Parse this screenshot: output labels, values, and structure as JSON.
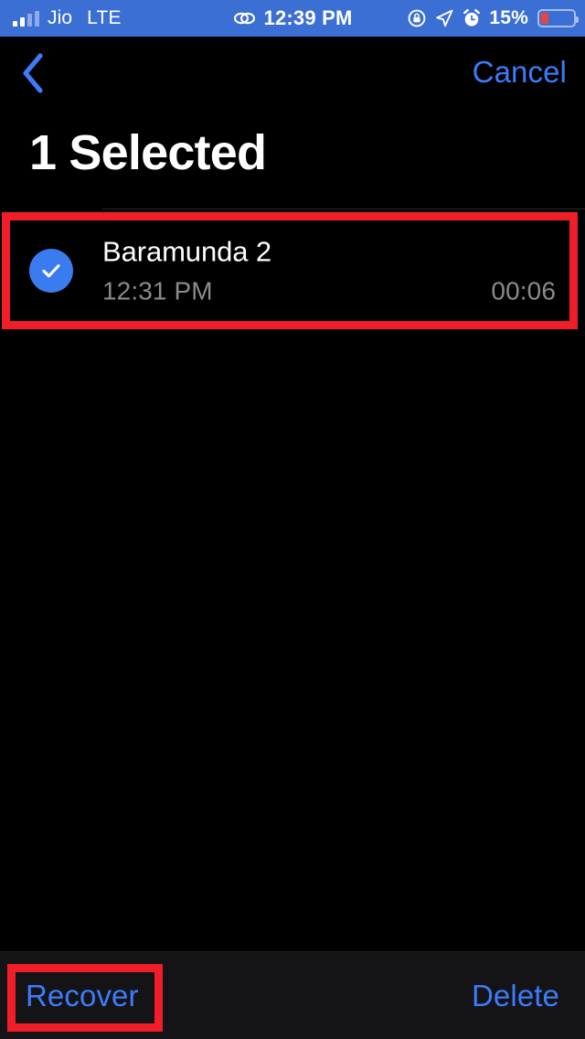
{
  "status_bar": {
    "carrier": "Jio",
    "network_type": "LTE",
    "time": "12:39 PM",
    "battery_percent": "15%",
    "battery_level": 15,
    "signal_bars_filled": 2,
    "signal_bars_total": 4,
    "icons": [
      "signal-bars-icon",
      "link-icon",
      "rotation-lock-icon",
      "location-arrow-icon",
      "alarm-clock-icon",
      "battery-icon"
    ],
    "colors": {
      "background": "#3B6FD4",
      "foreground": "#FFFFFF",
      "battery_fill": "#E8453C"
    }
  },
  "nav_bar": {
    "back_label": "",
    "cancel_label": "Cancel"
  },
  "header": {
    "title": "1 Selected"
  },
  "list": {
    "items": [
      {
        "title": "Baramunda 2",
        "time": "12:31 PM",
        "duration": "00:06",
        "selected": true
      }
    ]
  },
  "toolbar": {
    "recover_label": "Recover",
    "delete_label": "Delete"
  },
  "annotations": {
    "highlight_color": "#F01E28",
    "highlight_targets": [
      "selected-memo-row",
      "recover-button"
    ]
  },
  "theme": {
    "background": "#000000",
    "accent_blue": "#3D7BFB",
    "checkbox_blue": "#3B7BF0",
    "secondary_text": "#8A8A8E",
    "toolbar_background": "#141416"
  }
}
